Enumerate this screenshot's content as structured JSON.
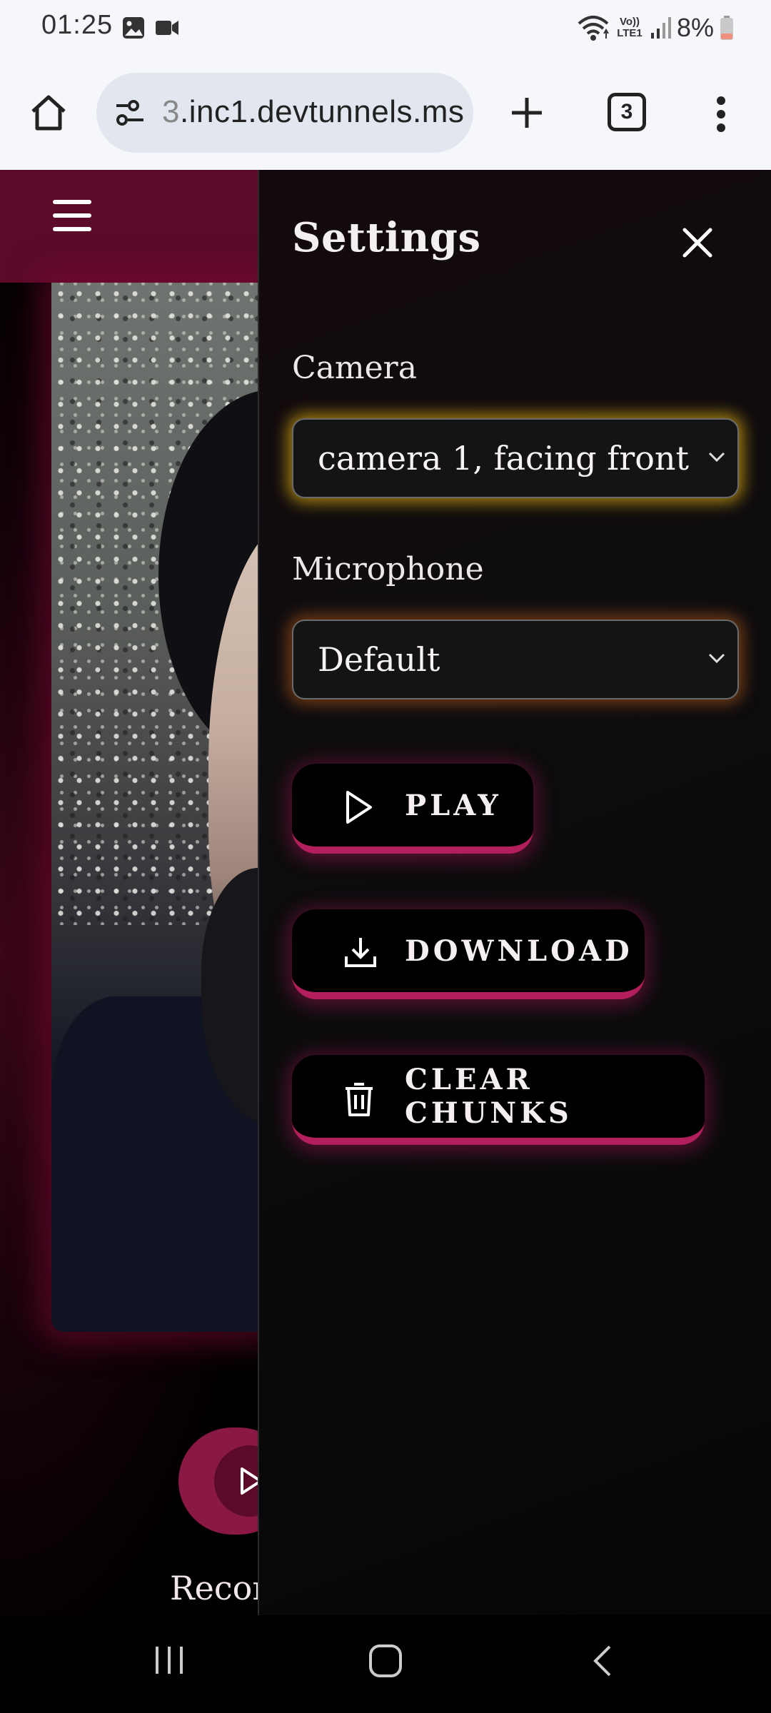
{
  "status_bar": {
    "time": "01:25",
    "battery": "8%",
    "icons": [
      "gallery-icon",
      "video-call-icon",
      "wifi-icon",
      "volte-lte1-icon",
      "signal-icon",
      "battery-low-icon"
    ],
    "volte_text": "Vo)) LTE1"
  },
  "browser": {
    "url_faded": "3",
    "url_main": ".inc1.devtunnels.ms",
    "tab_count": "3"
  },
  "app": {
    "record_label": "Recor"
  },
  "settings": {
    "title": "Settings",
    "camera_label": "Camera",
    "camera_value": "camera 1, facing front",
    "microphone_label": "Microphone",
    "microphone_value": "Default",
    "play_label": "PLAY",
    "download_label": "DOWNLOAD",
    "clear_label": "CLEAR CHUNKS"
  },
  "colors": {
    "brand": "#5c0a2a",
    "accent": "#b21f5c",
    "camera_glow": "#d6a812"
  }
}
